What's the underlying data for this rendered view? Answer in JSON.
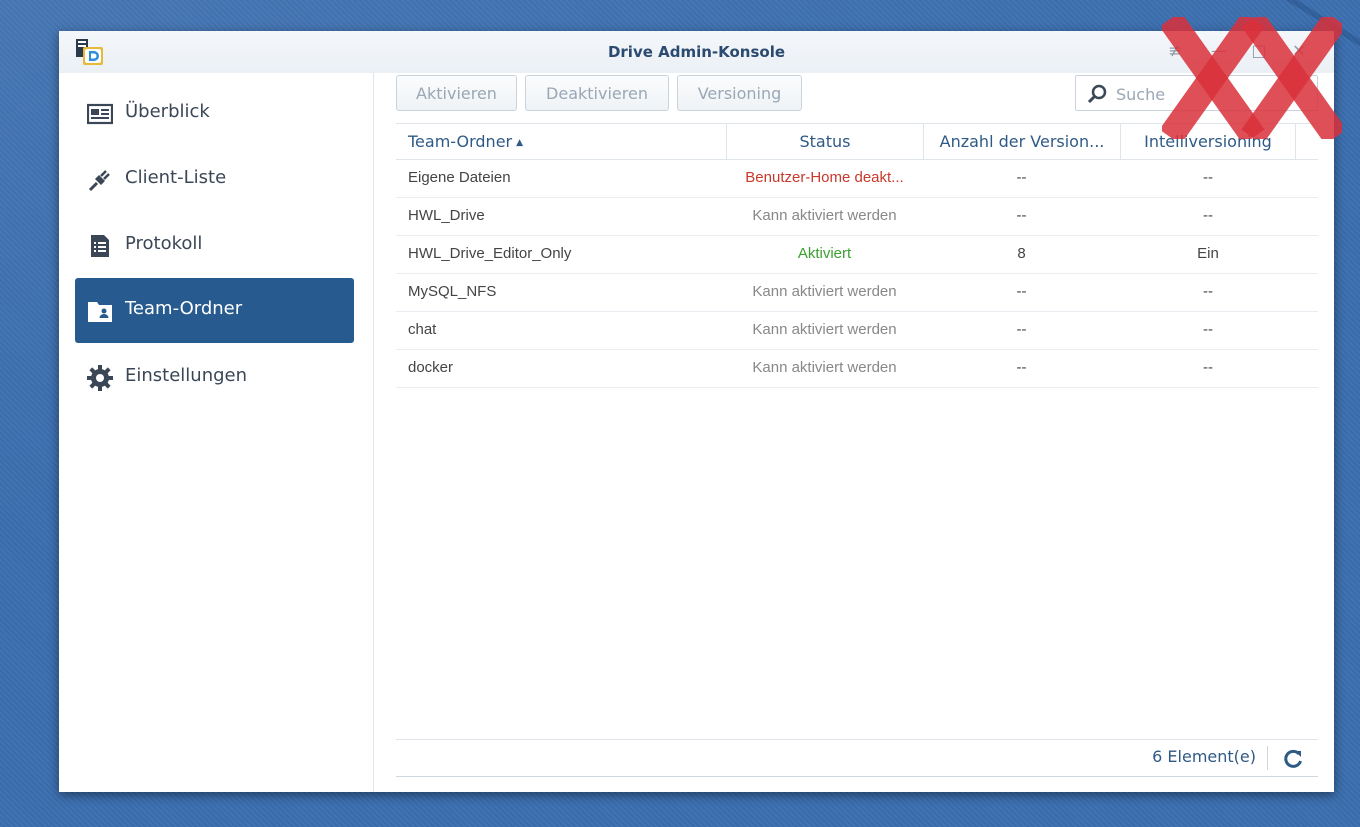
{
  "window": {
    "title": "Drive Admin-Konsole"
  },
  "sidebar": {
    "items": [
      {
        "label": "Überblick",
        "icon": "id-card-icon"
      },
      {
        "label": "Client-Liste",
        "icon": "plug-icon"
      },
      {
        "label": "Protokoll",
        "icon": "log-document-icon"
      },
      {
        "label": "Team-Ordner",
        "icon": "team-folder-icon",
        "active": true
      },
      {
        "label": "Einstellungen",
        "icon": "gear-icon"
      }
    ]
  },
  "toolbar": {
    "activate_label": "Aktivieren",
    "deactivate_label": "Deaktivieren",
    "versioning_label": "Versioning",
    "search_placeholder": "Suche"
  },
  "table": {
    "headers": [
      "Team-Ordner",
      "Status",
      "Anzahl der Version...",
      "Intelliversioning"
    ],
    "sort_column": "Team-Ordner",
    "sort_direction": "ascending",
    "rows": [
      {
        "name": "Eigene Dateien",
        "status": "Benutzer-Home deakt...",
        "versions": "--",
        "intelliversioning": "--"
      },
      {
        "name": "HWL_Drive",
        "status": "Kann aktiviert werden",
        "versions": "--",
        "intelliversioning": "--"
      },
      {
        "name": "HWL_Drive_Editor_Only",
        "status": "Aktiviert",
        "versions": "8",
        "intelliversioning": "Ein"
      },
      {
        "name": "MySQL_NFS",
        "status": "Kann aktiviert werden",
        "versions": "--",
        "intelliversioning": "--"
      },
      {
        "name": "chat",
        "status": "Kann aktiviert werden",
        "versions": "--",
        "intelliversioning": "--"
      },
      {
        "name": "docker",
        "status": "Kann aktiviert werden",
        "versions": "--",
        "intelliversioning": "--"
      }
    ]
  },
  "footer": {
    "count_label": "6 Element(e)"
  },
  "colors": {
    "desktop": "#3b6eb0",
    "active_nav": "#275a8e",
    "status_disabled_home": "#c8392b",
    "status_active": "#3aa02f",
    "status_available": "#888888",
    "overlay_x": "#d9303a"
  }
}
